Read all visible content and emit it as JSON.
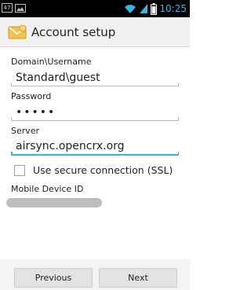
{
  "status_bar": {
    "notification_badge": "47",
    "time": "10:25",
    "icons": [
      "notification-badge-icon",
      "image-icon",
      "wifi-icon",
      "signal-icon",
      "battery-icon"
    ]
  },
  "action_bar": {
    "title": "Account setup",
    "icon": "email-app-icon"
  },
  "form": {
    "domain_label": "Domain\\Username",
    "domain_value": "Standard\\guest",
    "password_label": "Password",
    "password_value": "•••••",
    "server_label": "Server",
    "server_value": "airsync.opencrx.org",
    "ssl_label": "Use secure connection (SSL)",
    "ssl_checked": false,
    "device_id_label": "Mobile Device ID"
  },
  "buttons": {
    "previous": "Previous",
    "next": "Next"
  },
  "colors": {
    "accent": "#33b5e5",
    "status_bar": "#000000"
  }
}
